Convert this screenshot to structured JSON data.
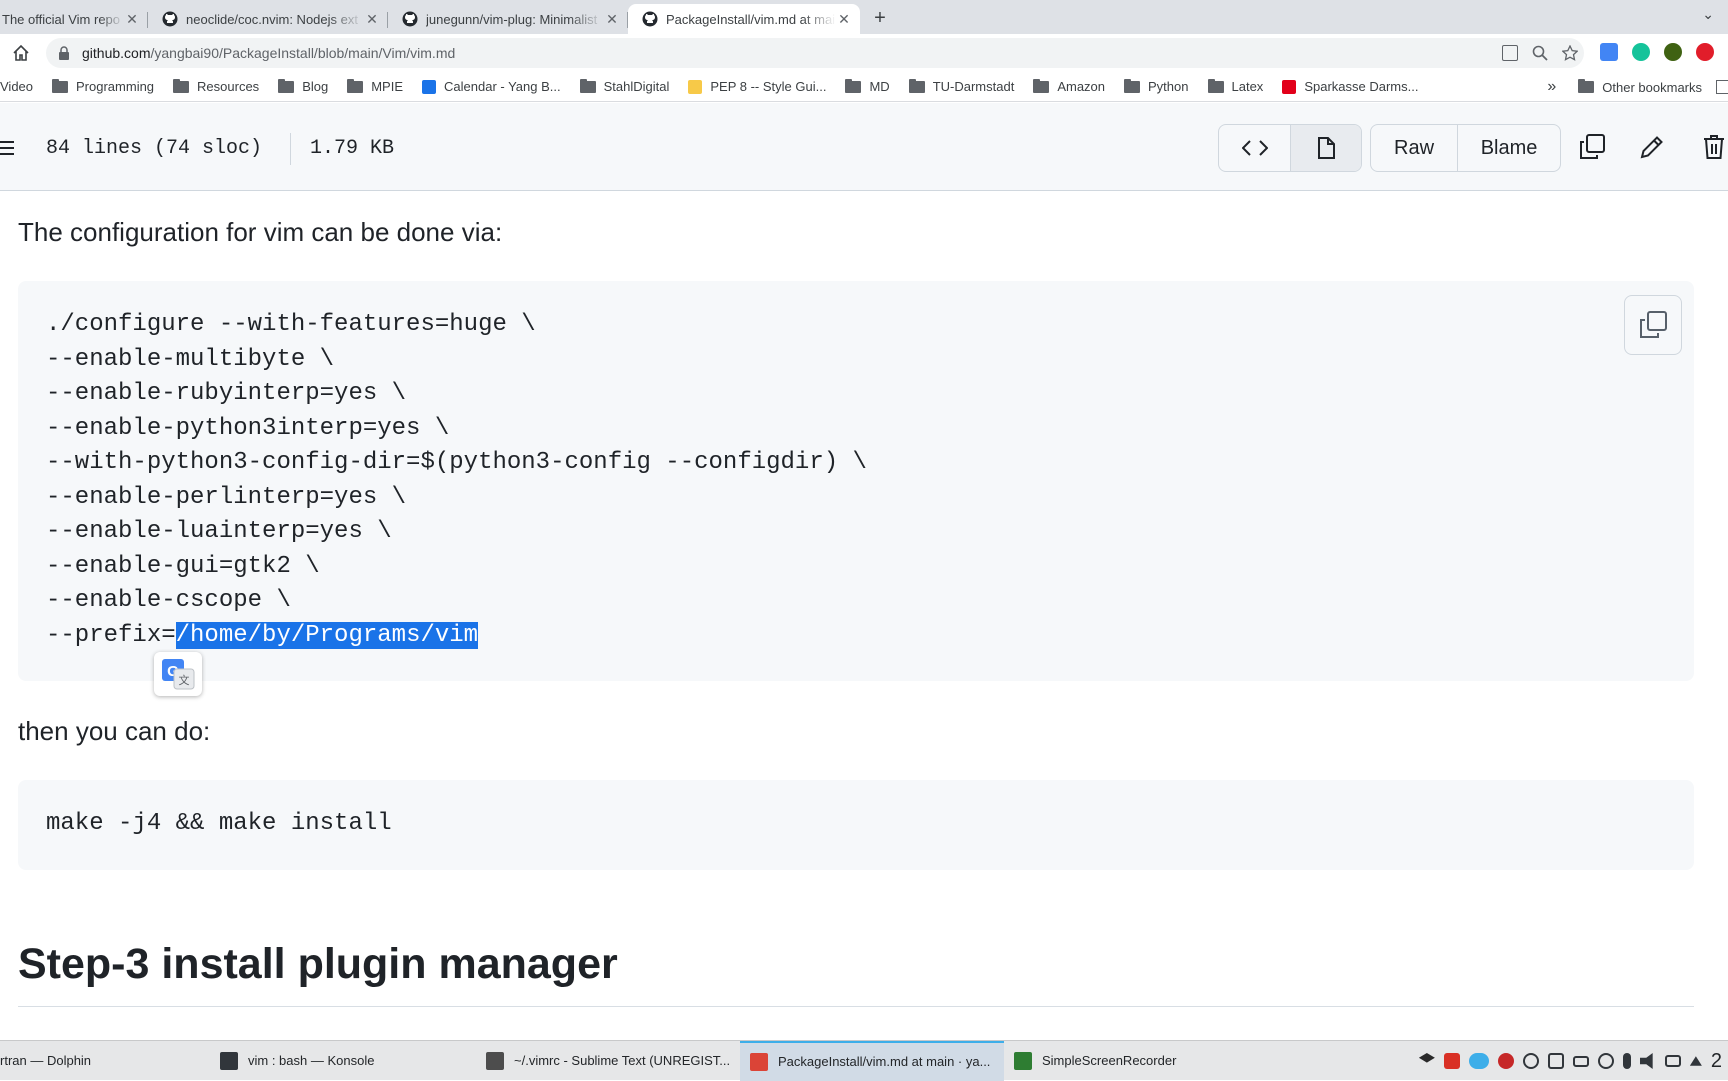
{
  "browser": {
    "tabs": [
      {
        "title": "The official Vim repo",
        "active": false
      },
      {
        "title": "neoclide/coc.nvim: Nodejs ext",
        "active": false
      },
      {
        "title": "junegunn/vim-plug: Minimalist",
        "active": false
      },
      {
        "title": "PackageInstall/vim.md at main",
        "active": true
      }
    ],
    "new_tab": "+",
    "tab_menu": "⌄",
    "url_host": "github.com",
    "url_path": "/yangbai90/PackageInstall/blob/main/Vim/vim.md",
    "bookmarks": [
      {
        "label": "Video",
        "icon": "none"
      },
      {
        "label": "Programming",
        "icon": "folder"
      },
      {
        "label": "Resources",
        "icon": "folder"
      },
      {
        "label": "Blog",
        "icon": "folder"
      },
      {
        "label": "MPIE",
        "icon": "folder"
      },
      {
        "label": "Calendar - Yang B...",
        "icon": "calendar"
      },
      {
        "label": "StahlDigital",
        "icon": "folder"
      },
      {
        "label": "PEP 8 -- Style Gui...",
        "icon": "python"
      },
      {
        "label": "MD",
        "icon": "folder"
      },
      {
        "label": "TU-Darmstadt",
        "icon": "folder"
      },
      {
        "label": "Amazon",
        "icon": "folder"
      },
      {
        "label": "Python",
        "icon": "folder"
      },
      {
        "label": "Latex",
        "icon": "folder"
      },
      {
        "label": "Sparkasse Darms...",
        "icon": "sparkasse"
      }
    ],
    "bookmarks_overflow": "»",
    "other_bookmarks": "Other bookmarks"
  },
  "file_header": {
    "lines": "84 lines (74 sloc)",
    "size": "1.79 KB",
    "raw": "Raw",
    "blame": "Blame"
  },
  "content": {
    "para1": "The configuration for vim can be done via:",
    "code1_lines": [
      "./configure --with-features=huge \\",
      "--enable-multibyte \\",
      "--enable-rubyinterp=yes \\",
      "--enable-python3interp=yes \\",
      "--with-python3-config-dir=$(python3-config --configdir) \\",
      "--enable-perlinterp=yes \\",
      "--enable-luainterp=yes \\",
      "--enable-gui=gtk2 \\",
      "--enable-cscope \\"
    ],
    "code1_last_prefix": "--prefix=",
    "code1_last_selected": "/home/by/Programs/vim",
    "para2": "then you can do:",
    "code2": "make -j4 && make install",
    "heading": "Step-3 install plugin manager"
  },
  "taskbar": {
    "tasks": [
      {
        "label": "rtran — Dolphin",
        "color": "#1d99f3"
      },
      {
        "label": "vim : bash — Konsole",
        "color": "#31363b"
      },
      {
        "label": "~/.vimrc - Sublime Text (UNREGIST...",
        "color": "#4d4d4d"
      },
      {
        "label": "PackageInstall/vim.md at main · ya...",
        "color": "#db4437"
      },
      {
        "label": "SimpleScreenRecorder",
        "color": "#2e7d32"
      }
    ],
    "clock": "2"
  },
  "colors": {
    "selection": "#1a73e8",
    "code_bg": "#f6f8fa"
  }
}
